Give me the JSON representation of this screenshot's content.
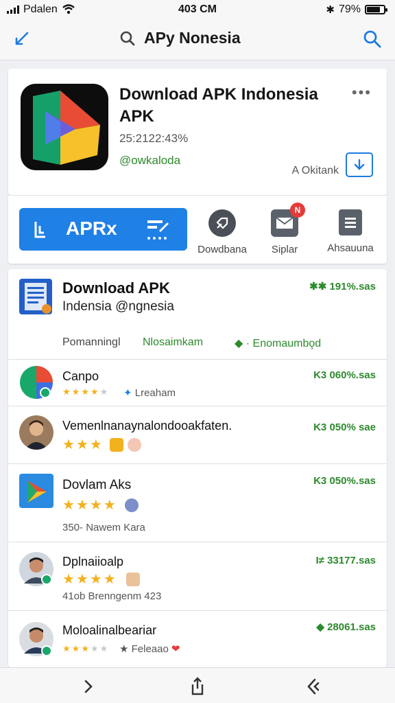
{
  "status": {
    "carrier": "Pdalen",
    "time": "403 CM",
    "battery_text": "79%",
    "battery_level": 0.79
  },
  "navbar": {
    "title": "APy Nonesia",
    "back_icon": "back-icon",
    "search_icon": "search-icon"
  },
  "app": {
    "name": "Download APK Indonesia APK",
    "version": "25:2122:43%",
    "developer": "@owkaloda",
    "install_label": "A Okitank"
  },
  "actions": {
    "primary": "APRx",
    "items": [
      {
        "label": "Dowdbana",
        "icon": "rocket-icon"
      },
      {
        "label": "Siplar",
        "icon": "mail-icon",
        "badge": "N"
      },
      {
        "label": "Ahsauuna",
        "icon": "list-icon"
      }
    ]
  },
  "featured": {
    "title": "Download APK",
    "subtitle": "Indensia @ngnesia",
    "size": "191%.sas",
    "foot": [
      "Pomanningl",
      "Nlosaimkam",
      "Enomaumbo̧d"
    ]
  },
  "rows": [
    {
      "name": "Canpo",
      "size": "060%.sas",
      "stars": 4,
      "sub": "Lreaham"
    },
    {
      "name": "Vemenlnanaynalondooakfaten.",
      "size": "050% sae",
      "stars": 3,
      "sub": ""
    },
    {
      "name": "Dovlam Aks",
      "size": "050%.sas",
      "stars": 4,
      "sub": "350- Nawem Kara"
    },
    {
      "name": "Dplnaiioalp",
      "size": "33177.sas",
      "stars": 4,
      "sub": "41ob Brenngenm 423"
    },
    {
      "name": "Moloalinalbeariar",
      "size": "28061.sas",
      "stars": 3,
      "sub": "Feleaao"
    }
  ],
  "colors": {
    "accent": "#1f80e6",
    "green": "#2c8a2c",
    "star": "#f2b11d"
  }
}
